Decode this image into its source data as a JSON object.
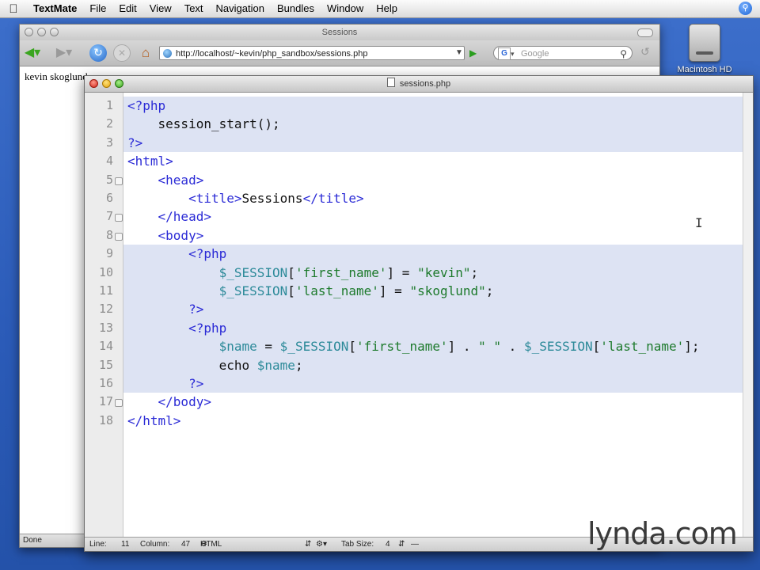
{
  "menubar": {
    "app_name": "TextMate",
    "items": [
      "File",
      "Edit",
      "View",
      "Text",
      "Navigation",
      "Bundles",
      "Window",
      "Help"
    ]
  },
  "desktop": {
    "drive_label": "Macintosh HD"
  },
  "browser": {
    "title": "Sessions",
    "url": "http://localhost/~kevin/php_sandbox/sessions.php",
    "search_placeholder": "Google",
    "page_text": "kevin skoglund",
    "status": "Done"
  },
  "editor": {
    "title": "sessions.php",
    "lines": [
      {
        "n": "1",
        "fold": false,
        "php": true,
        "parts": [
          {
            "c": "tag",
            "t": "<?php"
          }
        ]
      },
      {
        "n": "2",
        "fold": false,
        "php": true,
        "parts": [
          {
            "c": "txt",
            "t": "    session_start();"
          }
        ]
      },
      {
        "n": "3",
        "fold": false,
        "php": true,
        "parts": [
          {
            "c": "tag",
            "t": "?>"
          }
        ]
      },
      {
        "n": "4",
        "fold": false,
        "php": false,
        "parts": [
          {
            "c": "tag",
            "t": "<html>"
          }
        ]
      },
      {
        "n": "5",
        "fold": true,
        "php": false,
        "parts": [
          {
            "c": "tag",
            "t": "    <head>"
          }
        ]
      },
      {
        "n": "6",
        "fold": false,
        "php": false,
        "parts": [
          {
            "c": "tag",
            "t": "        <title>"
          },
          {
            "c": "txt",
            "t": "Sessions"
          },
          {
            "c": "tag",
            "t": "</title>"
          }
        ]
      },
      {
        "n": "7",
        "fold": true,
        "php": false,
        "parts": [
          {
            "c": "tag",
            "t": "    </head>"
          }
        ]
      },
      {
        "n": "8",
        "fold": true,
        "php": false,
        "parts": [
          {
            "c": "tag",
            "t": "    <body>"
          }
        ]
      },
      {
        "n": "9",
        "fold": false,
        "php": true,
        "parts": [
          {
            "c": "tag",
            "t": "        <?php"
          }
        ]
      },
      {
        "n": "10",
        "fold": false,
        "php": true,
        "parts": [
          {
            "c": "var",
            "t": "            $_SESSION"
          },
          {
            "c": "txt",
            "t": "["
          },
          {
            "c": "str",
            "t": "'first_name'"
          },
          {
            "c": "txt",
            "t": "] = "
          },
          {
            "c": "str",
            "t": "\"kevin\""
          },
          {
            "c": "txt",
            "t": ";"
          }
        ]
      },
      {
        "n": "11",
        "fold": false,
        "php": true,
        "parts": [
          {
            "c": "var",
            "t": "            $_SESSION"
          },
          {
            "c": "txt",
            "t": "["
          },
          {
            "c": "str",
            "t": "'last_name'"
          },
          {
            "c": "txt",
            "t": "] = "
          },
          {
            "c": "str",
            "t": "\"skoglund\""
          },
          {
            "c": "txt",
            "t": ";"
          }
        ]
      },
      {
        "n": "12",
        "fold": false,
        "php": true,
        "parts": [
          {
            "c": "tag",
            "t": "        ?>"
          }
        ]
      },
      {
        "n": "13",
        "fold": false,
        "php": true,
        "parts": [
          {
            "c": "tag",
            "t": "        <?php"
          }
        ]
      },
      {
        "n": "14",
        "fold": false,
        "php": true,
        "parts": [
          {
            "c": "var",
            "t": "            $name"
          },
          {
            "c": "txt",
            "t": " = "
          },
          {
            "c": "var",
            "t": "$_SESSION"
          },
          {
            "c": "txt",
            "t": "["
          },
          {
            "c": "str",
            "t": "'first_name'"
          },
          {
            "c": "txt",
            "t": "] . "
          },
          {
            "c": "str",
            "t": "\" \""
          },
          {
            "c": "txt",
            "t": " . "
          },
          {
            "c": "var",
            "t": "$_SESSION"
          },
          {
            "c": "txt",
            "t": "["
          },
          {
            "c": "str",
            "t": "'last_name'"
          },
          {
            "c": "txt",
            "t": "];"
          }
        ]
      },
      {
        "n": "15",
        "fold": false,
        "php": true,
        "parts": [
          {
            "c": "txt",
            "t": "            echo "
          },
          {
            "c": "var",
            "t": "$name"
          },
          {
            "c": "txt",
            "t": ";"
          }
        ]
      },
      {
        "n": "16",
        "fold": false,
        "php": true,
        "parts": [
          {
            "c": "tag",
            "t": "        ?>"
          }
        ]
      },
      {
        "n": "17",
        "fold": true,
        "php": false,
        "parts": [
          {
            "c": "tag",
            "t": "    </body>"
          }
        ]
      },
      {
        "n": "18",
        "fold": false,
        "php": false,
        "parts": [
          {
            "c": "tag",
            "t": "</html>"
          }
        ]
      }
    ],
    "status": {
      "line_label": "Line:",
      "line_value": "11",
      "column_label": "Column:",
      "column_value": "47",
      "language": "HTML",
      "tab_size_label": "Tab Size:",
      "tab_size_value": "4"
    }
  },
  "watermark": "lynda.com",
  "colors": {
    "tag": "#2b2bd6",
    "var": "#2c8a99",
    "str": "#1d7a2c",
    "php_bg": "#dde3f3"
  }
}
